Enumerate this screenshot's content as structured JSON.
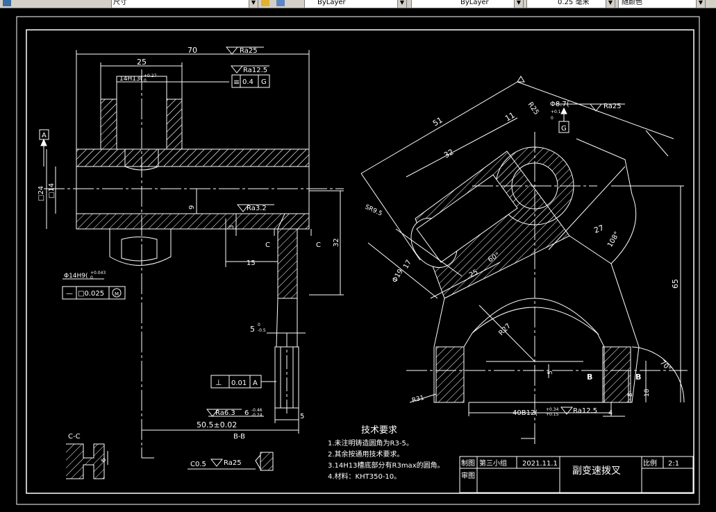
{
  "toolbar": {
    "dimstyle_value": "尺寸",
    "color_value": "ByLayer",
    "linetype_value": "ByLayer",
    "lineweight_value": "0.25 毫米",
    "plotstyle_value": "随颜色"
  },
  "title_block": {
    "drawn_label": "制图",
    "group": "第三小组",
    "date": "2021.11.1",
    "review_label": "审图",
    "part_name": "副变速拨叉",
    "scale_label": "比例",
    "scale_value": "2:1"
  },
  "notes": {
    "heading": "技术要求",
    "items": [
      "1.未注明铸造圆角为R3-5。",
      "2.其余按通用技术要求。",
      "3.14H13槽底部分有R3max的圆角。",
      "4.材料：KHT350-10。"
    ]
  },
  "front_view": {
    "dim_70": "70",
    "dim_25": "25",
    "ra25_top": "Ra25",
    "slot_fit": "14H13(",
    "slot_tol": "+0.27",
    "slot_tol_low": "0",
    "ra125": "Ra12.5",
    "fcf_sym": "≡",
    "fcf_val": "0.4",
    "fcf_datum": "G",
    "datum_a": "A",
    "dim_24": "□24",
    "dim_14": "□14",
    "dim_9": "9",
    "ra32": "Ra3.2",
    "dim_3": "3",
    "dim_15": "15",
    "section_c_left": "C",
    "section_c_right": "C",
    "dim_32": "32",
    "hole_fit": "Φ14H9(",
    "hole_tol": "+0.043",
    "hole_tol_low": "0",
    "perp_sym": "—",
    "perp_val": "□0.025",
    "perp_mod": "M",
    "dim_5": "5",
    "dim_5_tol": "0",
    "dim_5_tol2": "-0.5",
    "perp2_sym": "⊥",
    "perp2_val": "0.01",
    "perp2_datum": "A",
    "ra63": "Ra6.3",
    "dim_6": "6",
    "dim_6_tol": "-0.46",
    "dim_6_tol2": "-0.24",
    "dim_505": "50.5±0.02",
    "dim_5b": "5",
    "bb_label": "B-B"
  },
  "side_view": {
    "r25": "R25",
    "phi87": "Φ8.7(",
    "phi87_tol": "+0.1",
    "phi87_tol2": "0",
    "ra25": "Ra25",
    "datum_g": "G",
    "dim_51": "51",
    "dim_11": "11",
    "dim_32": "32",
    "sr": "SR9.5",
    "dim_17": "17",
    "dim_19": "Φ19",
    "dim_25": "25",
    "ang_60": "60°",
    "dim_27": "27",
    "ang_108": "108°",
    "dim_65": "65",
    "r27": "R27",
    "dim_5": "5",
    "r31": "R31",
    "sec_b1": "B",
    "sec_b2": "B",
    "dim_8": "8",
    "dim_18": "18",
    "ang_70": "70°",
    "dim_40": "40B12(",
    "dim_40_tol": "+0.34",
    "dim_40_tol2": "+0.15",
    "ra125": "Ra12.5",
    "dim_4": "4"
  },
  "cc_view": {
    "label": "C-C",
    "dim_6": "6"
  },
  "chamfer": {
    "label": "C0.5",
    "ra": "Ra25"
  }
}
